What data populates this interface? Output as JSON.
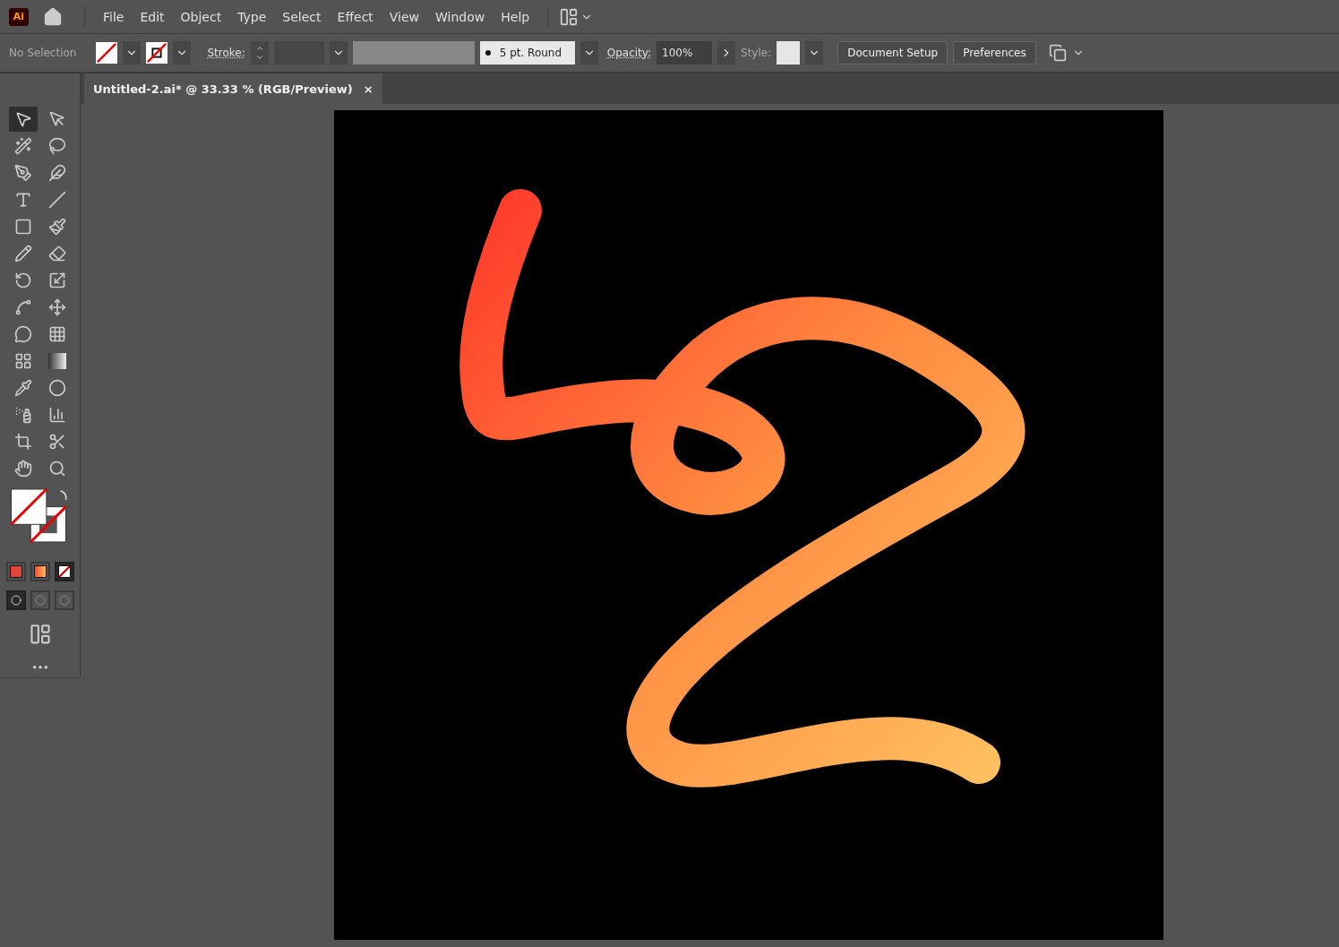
{
  "app_logo": "Ai",
  "menu": [
    "File",
    "Edit",
    "Object",
    "Type",
    "Select",
    "Effect",
    "View",
    "Window",
    "Help"
  ],
  "control_bar": {
    "selection": "No Selection",
    "stroke_label": "Stroke:",
    "brush": "5 pt. Round",
    "opacity_label": "Opacity:",
    "opacity": "100%",
    "style_label": "Style:",
    "buttons": [
      "Document Setup",
      "Preferences"
    ]
  },
  "document_tab": {
    "title": "Untitled-2.ai* @ 33.33 % (RGB/Preview)",
    "close": "×",
    "selected": true
  },
  "tools": [
    {
      "selected": true
    },
    {
      "selected": false
    },
    {
      "selected": false
    },
    {
      "selected": false
    },
    {
      "selected": false
    },
    {
      "selected": false
    },
    {
      "selected": false
    },
    {
      "selected": false
    },
    {
      "selected": false
    },
    {
      "selected": false
    },
    {
      "selected": false
    },
    {
      "selected": false
    },
    {
      "selected": false
    },
    {
      "selected": false
    },
    {
      "selected": false
    },
    {
      "selected": false
    },
    {
      "selected": false
    },
    {
      "selected": false
    },
    {
      "selected": false
    },
    {
      "selected": false
    },
    {
      "selected": false
    },
    {
      "selected": false
    },
    {
      "selected": false
    },
    {
      "selected": false
    },
    {
      "selected": false
    },
    {
      "selected": false
    },
    {
      "selected": false
    },
    {
      "selected": false
    }
  ],
  "color_modes": [
    {
      "kind": "color",
      "selected": false
    },
    {
      "kind": "gradient",
      "selected": false
    },
    {
      "kind": "none",
      "selected": true
    }
  ],
  "draw_modes": [
    {
      "selected": true
    },
    {
      "selected": false
    },
    {
      "selected": false
    }
  ]
}
